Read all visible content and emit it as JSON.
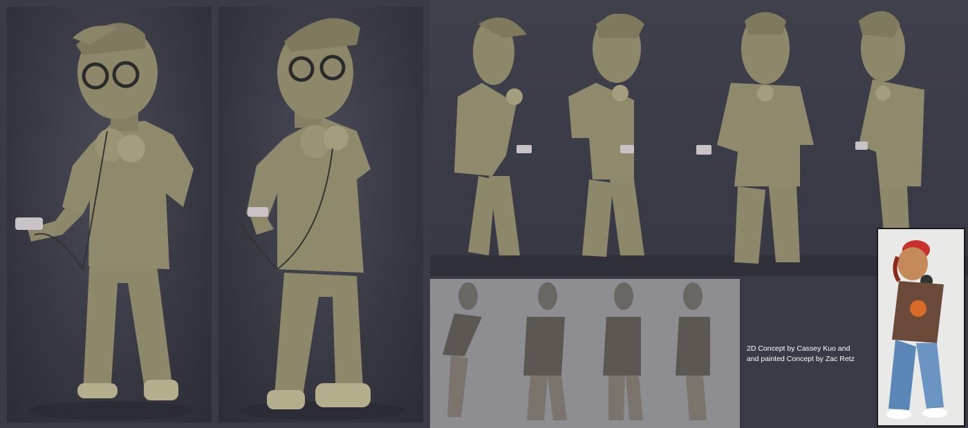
{
  "credits": {
    "line1": "2D Concept by Cassey Kuo and",
    "line2": "and painted Concept by  Zac Retz"
  },
  "colors": {
    "background": "#3a3b46",
    "clay": "#8d886a",
    "clay_gray": "#6a6663",
    "concept_bg": "#e9e9e7"
  },
  "panels": [
    "clay-render-three-quarter",
    "clay-render-front-left",
    "turnaround-four-views",
    "grey-turnaround-four-views",
    "painted-concept"
  ]
}
